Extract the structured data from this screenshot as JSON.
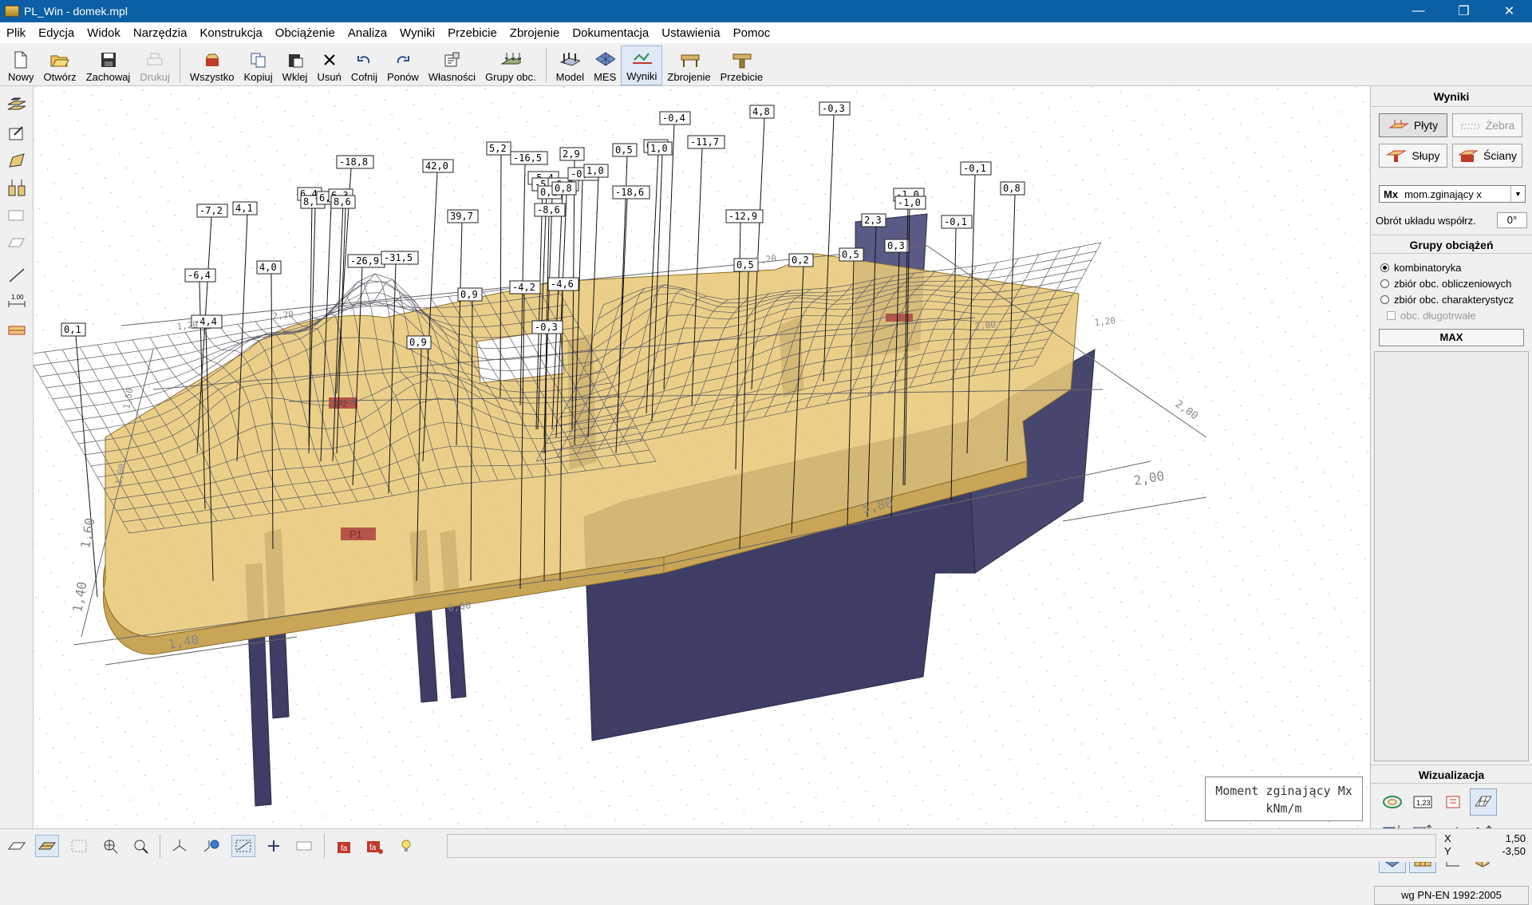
{
  "window": {
    "title": "PL_Win - domek.mpl",
    "controls": [
      "—",
      "❐",
      "✕"
    ]
  },
  "menu": [
    "Plik",
    "Edycja",
    "Widok",
    "Narzędzia",
    "Konstrukcja",
    "Obciążenie",
    "Analiza",
    "Wyniki",
    "Przebicie",
    "Zbrojenie",
    "Dokumentacja",
    "Ustawienia",
    "Pomoc"
  ],
  "toolbar": {
    "nowy": "Nowy",
    "otworz": "Otwórz",
    "zachowaj": "Zachowaj",
    "drukuj": "Drukuj",
    "wszystko": "Wszystko",
    "kopiuj": "Kopiuj",
    "wklej": "Wklej",
    "usun": "Usuń",
    "cofnij": "Cofnij",
    "ponow": "Ponów",
    "wlasnosci": "Własności",
    "grupy": "Grupy obc.",
    "model": "Model",
    "mes": "MES",
    "wyniki": "Wyniki",
    "zbrojenie": "Zbrojenie",
    "przebicie": "Przebicie"
  },
  "right_panel": {
    "title": "Wyniki",
    "plyty": "Płyty",
    "zebra": "Żebra",
    "slupy": "Słupy",
    "sciany": "Ściany",
    "combo_code": "Mx",
    "combo_value": "mom.zginający x",
    "rotation_label": "Obrót układu współrz.",
    "rotation_value": "0°",
    "groups_title": "Grupy obciążeń",
    "opt_kombinatoryka": "kombinatoryka",
    "opt_obliczeniowy": "zbiór obc. obliczeniowych",
    "opt_charakterystyczny": "zbiór obc. charakterystycz",
    "opt_dlugotrwale": "obc. długotrwałe",
    "max_button": "MAX",
    "viz_title": "Wizualizacja",
    "norm": "wg PN-EN 1992:2005"
  },
  "viewport": {
    "legend_line1": "Moment zginający Mx",
    "legend_line2": "kNm/m",
    "plate_tags": [
      "P2",
      "P1"
    ],
    "dimensions": [
      "1,40",
      "1,60",
      "1,40",
      "5,80",
      "2,00",
      "2,00",
      "1,20",
      "2,20",
      "1,20",
      "1,50",
      "1,00",
      "0,00",
      "2,00",
      "1,20"
    ],
    "labels": [
      "-7,2",
      "4,1",
      "-18,8",
      "42,0",
      "5,2",
      "-16,5",
      "2,9",
      "0,5",
      "0,9",
      "-0,4",
      "4,8",
      "-0,3",
      "-6,4",
      "4,0",
      "-4,4",
      "0,1",
      "6,4",
      "8,7",
      "6,",
      "6,3",
      "8,6",
      "-26,9",
      "-31,5",
      "39,7",
      "-5,4",
      "-5,2",
      "-0,2",
      "0,1",
      "0,8",
      "-0,6",
      "1,0",
      "1,0",
      "-18,6",
      "-11,7",
      "-8,6",
      "0,9",
      "0,9",
      "-4,2",
      "-4,6",
      "-0,3",
      "-12,9",
      "0,5",
      "0,2",
      "0,5",
      "2,3",
      "0,3",
      "-1,0",
      "-1,0",
      "-0,1",
      "-0,1",
      "0,8"
    ]
  },
  "status": {
    "x_label": "X",
    "x_value": "1,50",
    "y_label": "Y",
    "y_value": "-3,50"
  },
  "colors": {
    "titlebar": "#0b5fa5",
    "slab": "#e8c878",
    "wall": "#3d3d66",
    "mesh": "#5b5b66"
  }
}
